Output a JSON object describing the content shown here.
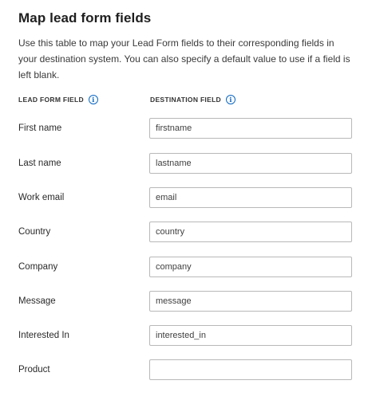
{
  "header": {
    "title": "Map lead form fields",
    "description": "Use this table to map your Lead Form fields to their corresponding fields in your destination system. You can also specify a default value to use if a field is left blank."
  },
  "columns": {
    "lead_form_field": "LEAD FORM FIELD",
    "destination_field": "DESTINATION FIELD",
    "info_icon": "info-icon"
  },
  "rows": [
    {
      "label": "First name",
      "value": "firstname"
    },
    {
      "label": "Last name",
      "value": "lastname"
    },
    {
      "label": "Work email",
      "value": "email"
    },
    {
      "label": "Country",
      "value": "country"
    },
    {
      "label": "Company",
      "value": "company"
    },
    {
      "label": "Message",
      "value": "message"
    },
    {
      "label": "Interested In",
      "value": "interested_in"
    },
    {
      "label": "Product",
      "value": ""
    }
  ],
  "colors": {
    "accent": "#0a66c2",
    "input_border": "#b8b8b8"
  }
}
